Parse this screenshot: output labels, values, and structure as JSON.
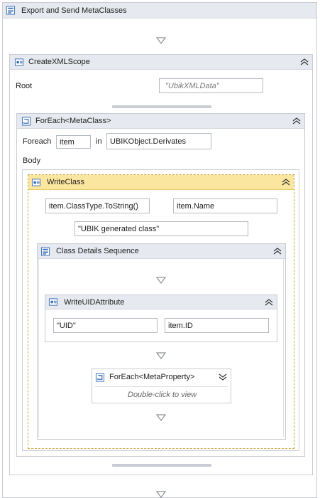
{
  "root_activity": {
    "title": "Export and Send MetaClasses"
  },
  "create_xml_scope": {
    "title": "CreateXMLScope",
    "root_label": "Root",
    "root_value": "\"UbikXMLData\""
  },
  "foreach_metaclass": {
    "title": "ForEach<MetaClass>",
    "foreach_label": "Foreach",
    "item_value": "item",
    "in_label": "in",
    "collection_value": "UBIKObject.Derivates",
    "body_label": "Body"
  },
  "write_class": {
    "title": "WriteClass",
    "field1": "item.ClassType.ToString()",
    "field2": "item.Name",
    "field3": "\"UBIK generated class\""
  },
  "class_details_sequence": {
    "title": "Class Details Sequence"
  },
  "write_uid_attribute": {
    "title": "WriteUIDAttribute",
    "field1": "\"UID\"",
    "field2": "item.ID"
  },
  "foreach_metaproperty": {
    "title": "ForEach<MetaProperty>",
    "hint": "Double-click to view"
  },
  "colors": {
    "header_bg": "#e6e9ef",
    "selected_header_bg": "#fbe6a0",
    "selection_border": "#c8a640",
    "border": "#c9ccd2"
  }
}
